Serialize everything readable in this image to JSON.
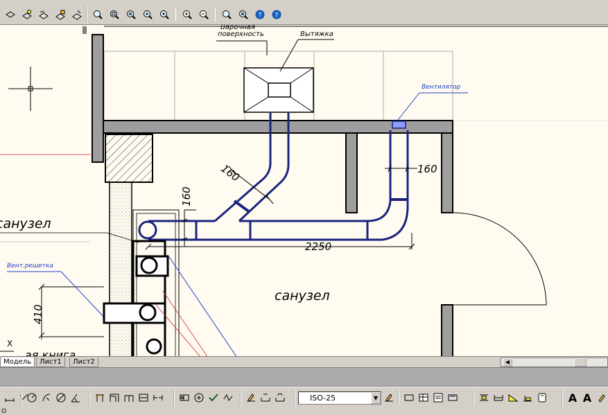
{
  "toolbar": {
    "zoom_group": [
      "zoom-realtime",
      "zoom-window",
      "zoom-previous",
      "zoom-in",
      "zoom-out",
      "zoom-all",
      "zoom-extents",
      "pan",
      "help"
    ]
  },
  "drawing": {
    "labels": {
      "cooking_surface_line1": "Варочная",
      "cooking_surface_line2": "поверхность",
      "hood": "Вытяжка",
      "fan": "Вентилятор",
      "bathroom_left": "санузел",
      "bathroom_center": "санузел",
      "vent_grille": "Вент.решетка",
      "dim_160_diag": "160",
      "dim_160_right": "160",
      "dim_160_vert": "160",
      "dim_2250": "2250",
      "dim_410": "410",
      "x_marker": "X",
      "partial_text": "ая книга"
    },
    "colors": {
      "duct": "#1a237e",
      "wall_fill": "#9e9e9e",
      "background": "#fffbf0",
      "fan_fill": "#8c9eff",
      "thin_blue": "#1e40c8",
      "red": "#c62828"
    }
  },
  "tabs": [
    {
      "label": "Модель",
      "active": true
    },
    {
      "label": "Лист1",
      "active": false
    },
    {
      "label": "Лист2",
      "active": false
    }
  ],
  "bottom": {
    "dimstyle": "ISO-25",
    "text_a1": "A",
    "text_a2": "A",
    "prompt": "О"
  }
}
